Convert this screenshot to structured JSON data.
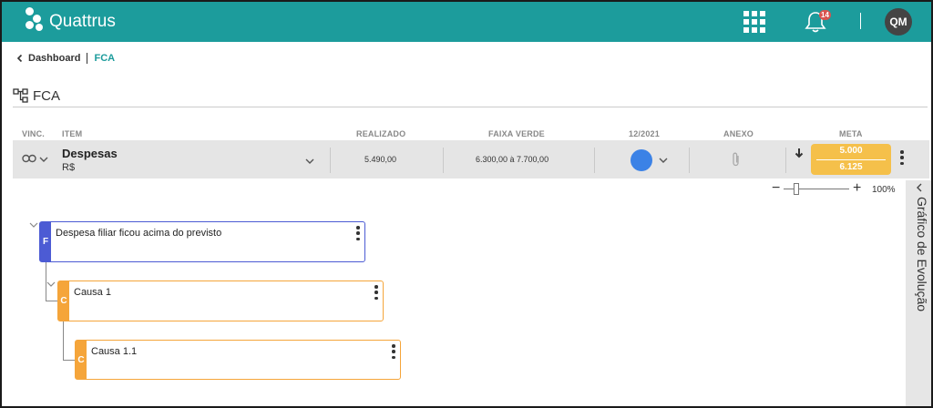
{
  "app": {
    "name": "Quattrus",
    "notification_count": "14",
    "user_initials": "QM"
  },
  "breadcrumb": {
    "parent": "Dashboard",
    "current": "FCA"
  },
  "page": {
    "title": "FCA"
  },
  "table": {
    "headers": {
      "vinc": "VINC.",
      "item": "ITEM",
      "realizado": "REALIZADO",
      "faixa_verde": "FAIXA VERDE",
      "period": "12/2021",
      "anexo": "ANEXO",
      "meta": "META"
    },
    "row": {
      "name": "Despesas",
      "unit": "R$",
      "realizado": "5.490,00",
      "faixa_verde": "6.300,00 à 7.700,00",
      "status_color": "#3b82e6",
      "meta_top": "5.000",
      "meta_bottom": "6.125"
    }
  },
  "zoom": {
    "value": "100%",
    "level": 0.2
  },
  "side_panel": {
    "label": "Gráfico de Evolução"
  },
  "tree": [
    {
      "tag": "F",
      "text": "Despesa filiar ficou acima do previsto",
      "color": "#4c5bd4"
    },
    {
      "tag": "C",
      "text": "Causa 1",
      "color": "#f5a53a"
    },
    {
      "tag": "C",
      "text": "Causa 1.1",
      "color": "#f5a53a"
    }
  ],
  "colors": {
    "brand": "#1c9c9c",
    "meta": "#f5c04a",
    "fact": "#4c5bd4",
    "cause": "#f5a53a"
  }
}
